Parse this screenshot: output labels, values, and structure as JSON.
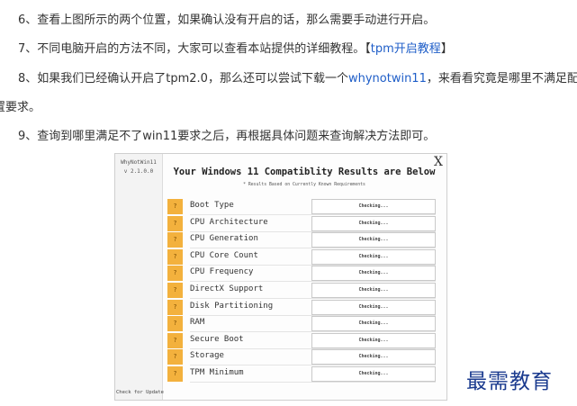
{
  "article": {
    "p6": "6、查看上图所示的两个位置，如果确认没有开启的话，那么需要手动进行开启。",
    "p7_text": "7、不同电脑开启的方法不同，大家可以查看本站提供的详细教程。",
    "p7_link": "tpm开启教程",
    "p8_before": "8、如果我们已经确认开启了tpm2.0，那么还可以尝试下载一个",
    "p8_link": "whynotwin11",
    "p8_after": "，来看看究竟是哪里不满足配",
    "p8_cont": "置要求。",
    "p9": "9、查询到哪里满足不了win11要求之后，再根据具体问题来查询解决方法即可。"
  },
  "panel": {
    "app_name": "WhyNotWin11",
    "version": "v 2.1.0.0",
    "heading": "Your Windows 11 Compatiblity Results are Below",
    "subheading": "* Results Based on Currently Known Requirements",
    "update_label": "Check for Update",
    "close_label": "X",
    "checks": [
      {
        "label": "Boot Type",
        "status": "Checking..."
      },
      {
        "label": "CPU Architecture",
        "status": "Checking..."
      },
      {
        "label": "CPU Generation",
        "status": "Checking..."
      },
      {
        "label": "CPU Core Count",
        "status": "Checking..."
      },
      {
        "label": "CPU Frequency",
        "status": "Checking..."
      },
      {
        "label": "DirectX Support",
        "status": "Checking..."
      },
      {
        "label": "Disk Partitioning",
        "status": "Checking..."
      },
      {
        "label": "RAM",
        "status": "Checking..."
      },
      {
        "label": "Secure Boot",
        "status": "Checking..."
      },
      {
        "label": "Storage",
        "status": "Checking..."
      },
      {
        "label": "TPM Minimum",
        "status": "Checking..."
      }
    ],
    "badge_glyph": "?"
  },
  "watermark": "最需教育"
}
